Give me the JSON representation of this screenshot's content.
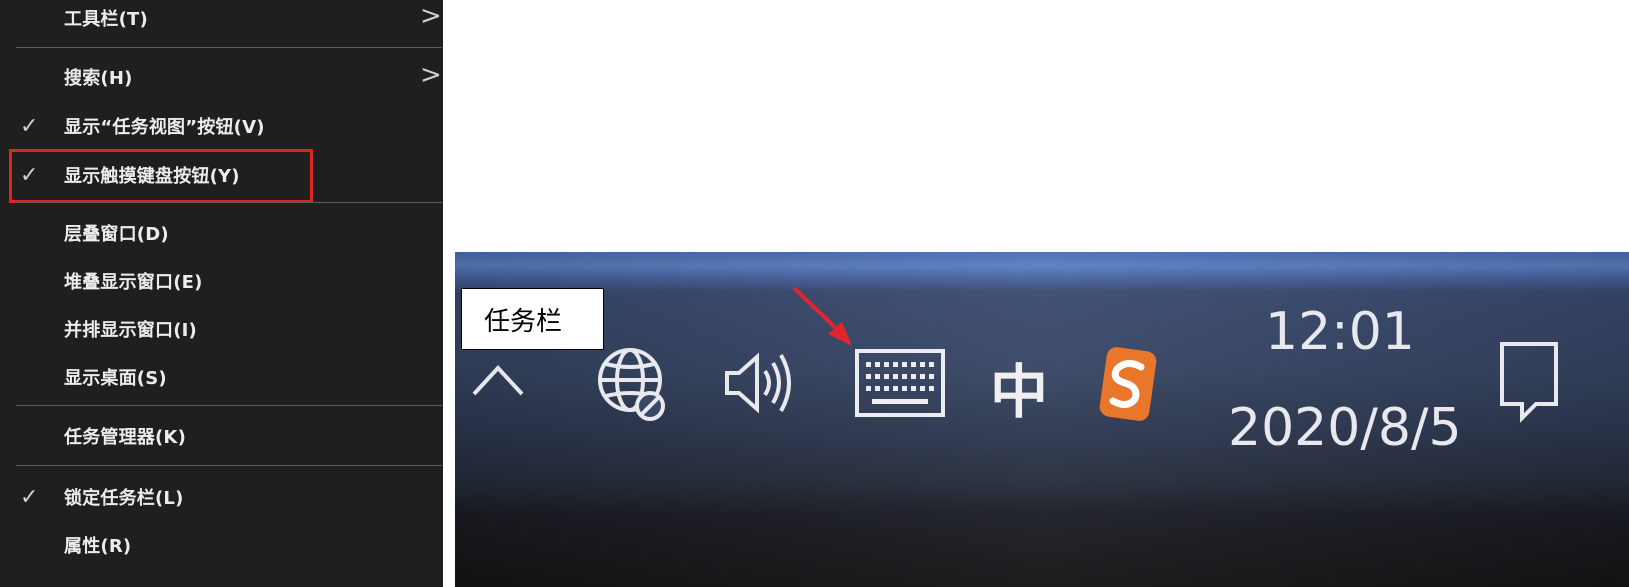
{
  "context_menu": {
    "items": [
      {
        "label": "工具栏(T)",
        "checked": false,
        "submenu": true
      },
      {
        "label": "搜索(H)",
        "checked": false,
        "submenu": true
      },
      {
        "label": "显示“任务视图”按钮(V)",
        "checked": true,
        "submenu": false
      },
      {
        "label": "显示触摸键盘按钮(Y)",
        "checked": true,
        "submenu": false,
        "highlighted": true
      },
      {
        "label": "层叠窗口(D)",
        "checked": false,
        "submenu": false
      },
      {
        "label": "堆叠显示窗口(E)",
        "checked": false,
        "submenu": false
      },
      {
        "label": "并排显示窗口(I)",
        "checked": false,
        "submenu": false
      },
      {
        "label": "显示桌面(S)",
        "checked": false,
        "submenu": false
      },
      {
        "label": "任务管理器(K)",
        "checked": false,
        "submenu": false
      },
      {
        "label": "锁定任务栏(L)",
        "checked": true,
        "submenu": false
      },
      {
        "label": "属性(R)",
        "checked": false,
        "submenu": false
      }
    ],
    "highlight_color": "#e02424"
  },
  "taskbar": {
    "callout_label": "任务栏",
    "ime_mode": "中",
    "clock_time": "12:01",
    "clock_date": "2020/8/5",
    "icons": [
      "chevron-up-icon",
      "globe-no-network-icon",
      "speaker-volume-icon",
      "touch-keyboard-icon",
      "sogou-ime-icon",
      "notification-icon"
    ],
    "arrow_color": "#e0262b",
    "sogou_color": "#e8762b"
  }
}
